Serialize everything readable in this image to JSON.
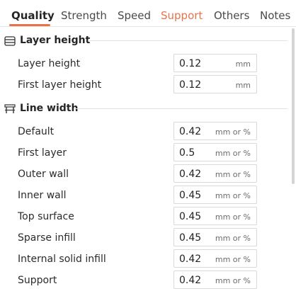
{
  "tabs": [
    {
      "label": "Quality"
    },
    {
      "label": "Strength"
    },
    {
      "label": "Speed"
    },
    {
      "label": "Support"
    },
    {
      "label": "Others"
    },
    {
      "label": "Notes"
    }
  ],
  "colors": {
    "accent": "#e8734a",
    "text": "#2b2b2b",
    "border": "#d9d9d9"
  },
  "sections": {
    "layer_height": {
      "title": "Layer height",
      "icon": "layers-icon",
      "rows": [
        {
          "label": "Layer height",
          "value": "0.12",
          "unit": "mm"
        },
        {
          "label": "First layer height",
          "value": "0.12",
          "unit": "mm"
        }
      ]
    },
    "line_width": {
      "title": "Line width",
      "icon": "line-width-icon",
      "rows": [
        {
          "label": "Default",
          "value": "0.42",
          "unit": "mm or %"
        },
        {
          "label": "First layer",
          "value": "0.5",
          "unit": "mm or %"
        },
        {
          "label": "Outer wall",
          "value": "0.42",
          "unit": "mm or %"
        },
        {
          "label": "Inner wall",
          "value": "0.45",
          "unit": "mm or %"
        },
        {
          "label": "Top surface",
          "value": "0.45",
          "unit": "mm or %"
        },
        {
          "label": "Sparse infill",
          "value": "0.45",
          "unit": "mm or %"
        },
        {
          "label": "Internal solid infill",
          "value": "0.42",
          "unit": "mm or %"
        },
        {
          "label": "Support",
          "value": "0.42",
          "unit": "mm or %"
        }
      ]
    }
  }
}
